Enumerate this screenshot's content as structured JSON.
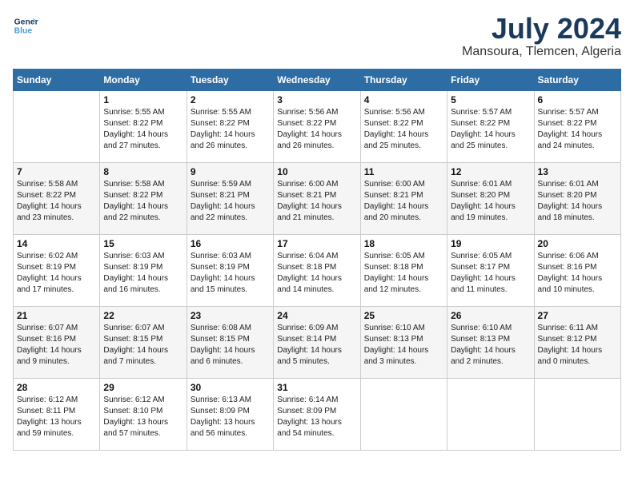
{
  "logo": {
    "line1": "General",
    "line2": "Blue"
  },
  "title": "July 2024",
  "location": "Mansoura, Tlemcen, Algeria",
  "days_of_week": [
    "Sunday",
    "Monday",
    "Tuesday",
    "Wednesday",
    "Thursday",
    "Friday",
    "Saturday"
  ],
  "weeks": [
    [
      {
        "day": "",
        "sunrise": "",
        "sunset": "",
        "daylight": ""
      },
      {
        "day": "1",
        "sunrise": "Sunrise: 5:55 AM",
        "sunset": "Sunset: 8:22 PM",
        "daylight": "Daylight: 14 hours and 27 minutes."
      },
      {
        "day": "2",
        "sunrise": "Sunrise: 5:55 AM",
        "sunset": "Sunset: 8:22 PM",
        "daylight": "Daylight: 14 hours and 26 minutes."
      },
      {
        "day": "3",
        "sunrise": "Sunrise: 5:56 AM",
        "sunset": "Sunset: 8:22 PM",
        "daylight": "Daylight: 14 hours and 26 minutes."
      },
      {
        "day": "4",
        "sunrise": "Sunrise: 5:56 AM",
        "sunset": "Sunset: 8:22 PM",
        "daylight": "Daylight: 14 hours and 25 minutes."
      },
      {
        "day": "5",
        "sunrise": "Sunrise: 5:57 AM",
        "sunset": "Sunset: 8:22 PM",
        "daylight": "Daylight: 14 hours and 25 minutes."
      },
      {
        "day": "6",
        "sunrise": "Sunrise: 5:57 AM",
        "sunset": "Sunset: 8:22 PM",
        "daylight": "Daylight: 14 hours and 24 minutes."
      }
    ],
    [
      {
        "day": "7",
        "sunrise": "Sunrise: 5:58 AM",
        "sunset": "Sunset: 8:22 PM",
        "daylight": "Daylight: 14 hours and 23 minutes."
      },
      {
        "day": "8",
        "sunrise": "Sunrise: 5:58 AM",
        "sunset": "Sunset: 8:22 PM",
        "daylight": "Daylight: 14 hours and 22 minutes."
      },
      {
        "day": "9",
        "sunrise": "Sunrise: 5:59 AM",
        "sunset": "Sunset: 8:21 PM",
        "daylight": "Daylight: 14 hours and 22 minutes."
      },
      {
        "day": "10",
        "sunrise": "Sunrise: 6:00 AM",
        "sunset": "Sunset: 8:21 PM",
        "daylight": "Daylight: 14 hours and 21 minutes."
      },
      {
        "day": "11",
        "sunrise": "Sunrise: 6:00 AM",
        "sunset": "Sunset: 8:21 PM",
        "daylight": "Daylight: 14 hours and 20 minutes."
      },
      {
        "day": "12",
        "sunrise": "Sunrise: 6:01 AM",
        "sunset": "Sunset: 8:20 PM",
        "daylight": "Daylight: 14 hours and 19 minutes."
      },
      {
        "day": "13",
        "sunrise": "Sunrise: 6:01 AM",
        "sunset": "Sunset: 8:20 PM",
        "daylight": "Daylight: 14 hours and 18 minutes."
      }
    ],
    [
      {
        "day": "14",
        "sunrise": "Sunrise: 6:02 AM",
        "sunset": "Sunset: 8:19 PM",
        "daylight": "Daylight: 14 hours and 17 minutes."
      },
      {
        "day": "15",
        "sunrise": "Sunrise: 6:03 AM",
        "sunset": "Sunset: 8:19 PM",
        "daylight": "Daylight: 14 hours and 16 minutes."
      },
      {
        "day": "16",
        "sunrise": "Sunrise: 6:03 AM",
        "sunset": "Sunset: 8:19 PM",
        "daylight": "Daylight: 14 hours and 15 minutes."
      },
      {
        "day": "17",
        "sunrise": "Sunrise: 6:04 AM",
        "sunset": "Sunset: 8:18 PM",
        "daylight": "Daylight: 14 hours and 14 minutes."
      },
      {
        "day": "18",
        "sunrise": "Sunrise: 6:05 AM",
        "sunset": "Sunset: 8:18 PM",
        "daylight": "Daylight: 14 hours and 12 minutes."
      },
      {
        "day": "19",
        "sunrise": "Sunrise: 6:05 AM",
        "sunset": "Sunset: 8:17 PM",
        "daylight": "Daylight: 14 hours and 11 minutes."
      },
      {
        "day": "20",
        "sunrise": "Sunrise: 6:06 AM",
        "sunset": "Sunset: 8:16 PM",
        "daylight": "Daylight: 14 hours and 10 minutes."
      }
    ],
    [
      {
        "day": "21",
        "sunrise": "Sunrise: 6:07 AM",
        "sunset": "Sunset: 8:16 PM",
        "daylight": "Daylight: 14 hours and 9 minutes."
      },
      {
        "day": "22",
        "sunrise": "Sunrise: 6:07 AM",
        "sunset": "Sunset: 8:15 PM",
        "daylight": "Daylight: 14 hours and 7 minutes."
      },
      {
        "day": "23",
        "sunrise": "Sunrise: 6:08 AM",
        "sunset": "Sunset: 8:15 PM",
        "daylight": "Daylight: 14 hours and 6 minutes."
      },
      {
        "day": "24",
        "sunrise": "Sunrise: 6:09 AM",
        "sunset": "Sunset: 8:14 PM",
        "daylight": "Daylight: 14 hours and 5 minutes."
      },
      {
        "day": "25",
        "sunrise": "Sunrise: 6:10 AM",
        "sunset": "Sunset: 8:13 PM",
        "daylight": "Daylight: 14 hours and 3 minutes."
      },
      {
        "day": "26",
        "sunrise": "Sunrise: 6:10 AM",
        "sunset": "Sunset: 8:13 PM",
        "daylight": "Daylight: 14 hours and 2 minutes."
      },
      {
        "day": "27",
        "sunrise": "Sunrise: 6:11 AM",
        "sunset": "Sunset: 8:12 PM",
        "daylight": "Daylight: 14 hours and 0 minutes."
      }
    ],
    [
      {
        "day": "28",
        "sunrise": "Sunrise: 6:12 AM",
        "sunset": "Sunset: 8:11 PM",
        "daylight": "Daylight: 13 hours and 59 minutes."
      },
      {
        "day": "29",
        "sunrise": "Sunrise: 6:12 AM",
        "sunset": "Sunset: 8:10 PM",
        "daylight": "Daylight: 13 hours and 57 minutes."
      },
      {
        "day": "30",
        "sunrise": "Sunrise: 6:13 AM",
        "sunset": "Sunset: 8:09 PM",
        "daylight": "Daylight: 13 hours and 56 minutes."
      },
      {
        "day": "31",
        "sunrise": "Sunrise: 6:14 AM",
        "sunset": "Sunset: 8:09 PM",
        "daylight": "Daylight: 13 hours and 54 minutes."
      },
      {
        "day": "",
        "sunrise": "",
        "sunset": "",
        "daylight": ""
      },
      {
        "day": "",
        "sunrise": "",
        "sunset": "",
        "daylight": ""
      },
      {
        "day": "",
        "sunrise": "",
        "sunset": "",
        "daylight": ""
      }
    ]
  ]
}
